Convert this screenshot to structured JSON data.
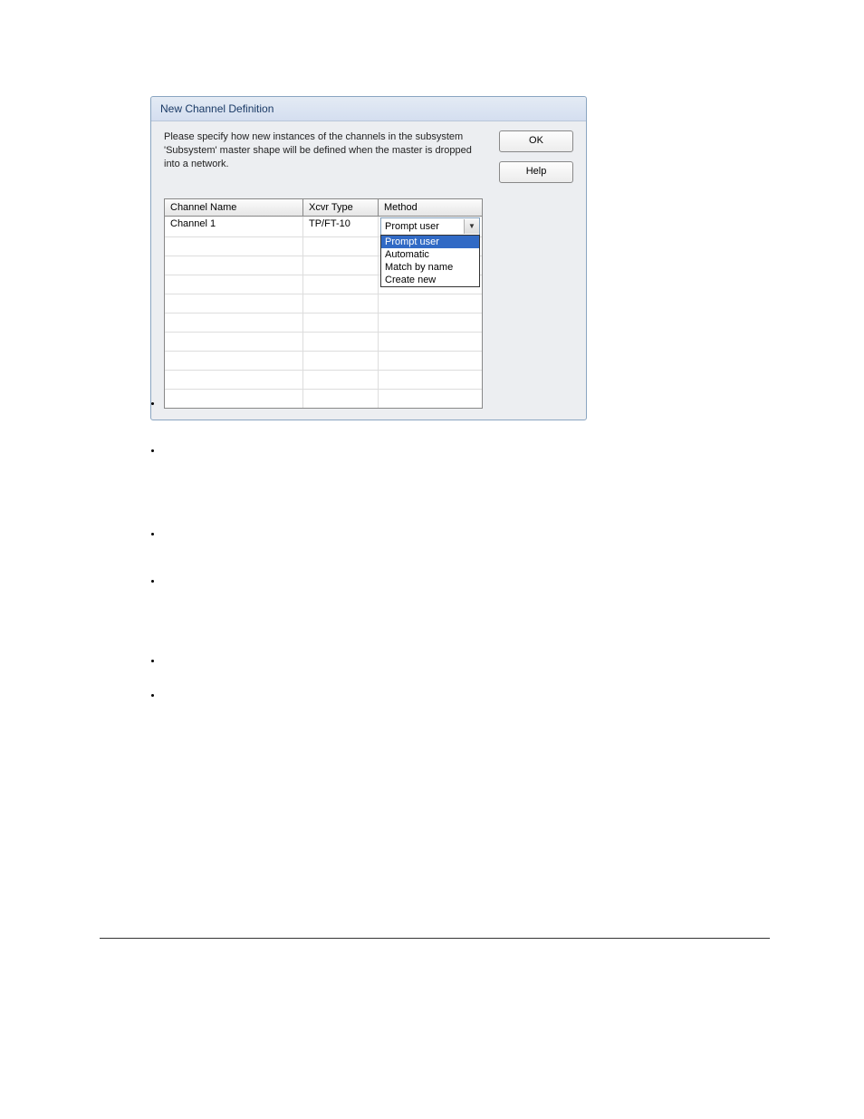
{
  "dialog": {
    "title": "New Channel Definition",
    "description": "Please specify how new instances of the channels in the subsystem 'Subsystem' master shape will be defined when the master is dropped into a network.",
    "buttons": {
      "ok": "OK",
      "help": "Help"
    },
    "table": {
      "headers": {
        "channel_name": "Channel Name",
        "xcvr_type": "Xcvr Type",
        "method": "Method"
      },
      "row": {
        "channel_name": "Channel 1",
        "xcvr_type": "TP/FT-10",
        "method_selected": "Prompt user"
      },
      "method_options": [
        "Prompt user",
        "Automatic",
        "Match by name",
        "Create new"
      ]
    }
  }
}
